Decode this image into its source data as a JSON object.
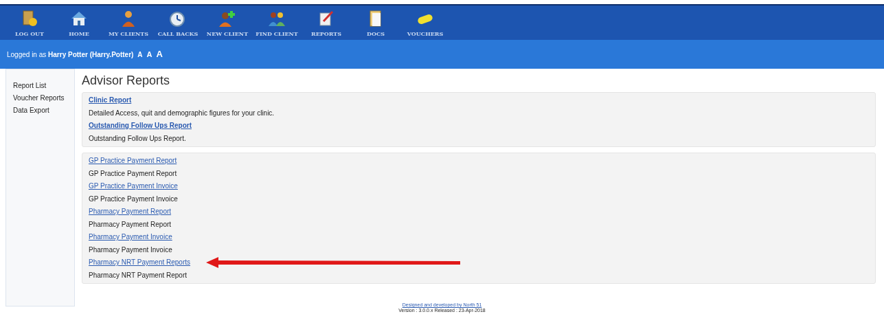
{
  "nav": [
    {
      "label": "LOG OUT"
    },
    {
      "label": "HOME"
    },
    {
      "label": "MY CLIENTS"
    },
    {
      "label": "CALL BACKS"
    },
    {
      "label": "NEW CLIENT"
    },
    {
      "label": "FIND CLIENT"
    },
    {
      "label": "REPORTS"
    },
    {
      "label": "DOCS"
    },
    {
      "label": "VOUCHERS"
    }
  ],
  "user_bar": {
    "prefix": "Logged in as",
    "user": "Harry Potter (Harry.Potter)",
    "font_sizes": [
      "A",
      "A",
      "A"
    ]
  },
  "sidebar": {
    "items": [
      "Report List",
      "Voucher Reports",
      "Data Export"
    ]
  },
  "page_title": "Advisor Reports",
  "groups": [
    {
      "bold_links": true,
      "items": [
        {
          "kind": "link",
          "text": "Clinic Report"
        },
        {
          "kind": "text",
          "text": "Detailed Access, quit and demographic figures for your clinic."
        },
        {
          "kind": "link",
          "text": "Outstanding Follow Ups Report"
        },
        {
          "kind": "text",
          "text": "Outstanding Follow Ups Report."
        }
      ]
    },
    {
      "bold_links": false,
      "items": [
        {
          "kind": "link",
          "text": "GP Practice Payment Report"
        },
        {
          "kind": "text",
          "text": "GP Practice Payment Report"
        },
        {
          "kind": "link",
          "text": "GP Practice Payment Invoice"
        },
        {
          "kind": "text",
          "text": "GP Practice Payment Invoice"
        },
        {
          "kind": "link",
          "text": "Pharmacy Payment Report"
        },
        {
          "kind": "text",
          "text": "Pharmacy Payment Report"
        },
        {
          "kind": "link",
          "text": "Pharmacy Payment Invoice"
        },
        {
          "kind": "text",
          "text": "Pharmacy Payment Invoice"
        },
        {
          "kind": "link",
          "text": "Pharmacy NRT Payment Reports",
          "pointed_at": true
        },
        {
          "kind": "text",
          "text": "Pharmacy NRT Payment Report"
        }
      ]
    }
  ],
  "footer": {
    "credit": "Designed and developed by North 51",
    "version": "Version : 3.0.0.x Released : 23-Apr-2018"
  }
}
